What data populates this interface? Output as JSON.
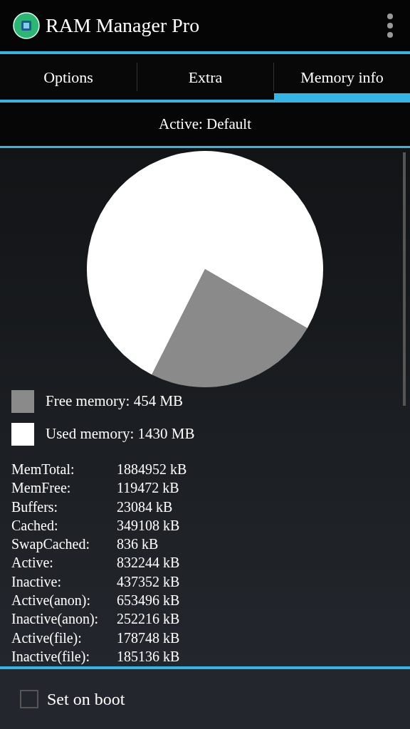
{
  "app_bar": {
    "title": "RAM Manager Pro"
  },
  "tabs": [
    {
      "label": "Options",
      "selected": false
    },
    {
      "label": "Extra",
      "selected": false
    },
    {
      "label": "Memory info",
      "selected": true
    }
  ],
  "profile": {
    "text": "Active: Default"
  },
  "memory": {
    "chart_data": {
      "type": "pie",
      "values": [
        24.1,
        75.9
      ]
    },
    "legend": [
      {
        "label": "Free memory: 454 MB",
        "color": "#8a8a8a"
      },
      {
        "label": "Used memory: 1430 MB",
        "color": "#ffffff"
      }
    ],
    "meminfo": [
      {
        "name": "MemTotal:",
        "value": "1884952 kB"
      },
      {
        "name": "MemFree:",
        "value": "119472 kB"
      },
      {
        "name": "Buffers:",
        "value": "23084 kB"
      },
      {
        "name": "Cached:",
        "value": "349108 kB"
      },
      {
        "name": "SwapCached:",
        "value": "836 kB"
      },
      {
        "name": "Active:",
        "value": "832244 kB"
      },
      {
        "name": "Inactive:",
        "value": "437352 kB"
      },
      {
        "name": "Active(anon):",
        "value": "653496 kB"
      },
      {
        "name": "Inactive(anon):",
        "value": "252216 kB"
      },
      {
        "name": "Active(file):",
        "value": "178748 kB"
      },
      {
        "name": "Inactive(file):",
        "value": "185136 kB"
      }
    ]
  },
  "footer": {
    "checkbox": {
      "label": "Set on boot",
      "checked": false
    }
  }
}
